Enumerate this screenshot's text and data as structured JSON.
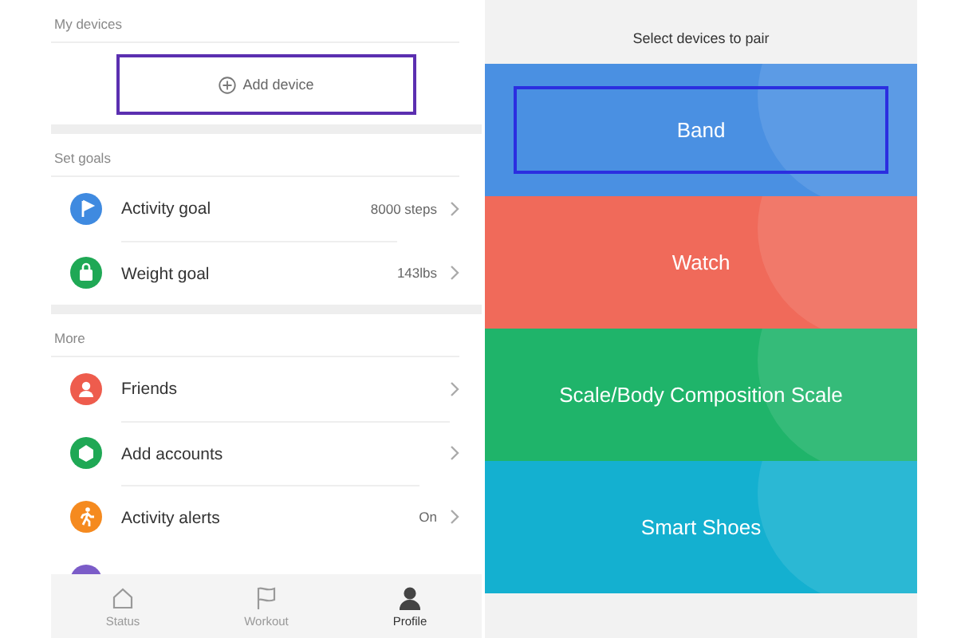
{
  "profile": {
    "my_devices": {
      "heading": "My devices",
      "add_device": {
        "label": "Add device",
        "highlighted": true
      }
    },
    "set_goals": {
      "heading": "Set goals",
      "items": [
        {
          "label": "Activity goal",
          "value": "8000 steps",
          "color": "#3f8ae0"
        },
        {
          "label": "Weight goal",
          "value": "143lbs",
          "color": "#1fa855"
        }
      ]
    },
    "more": {
      "heading": "More",
      "items": [
        {
          "label": "Friends",
          "color": "#ee5c4d"
        },
        {
          "label": "Add accounts",
          "color": "#1fa855"
        },
        {
          "label": "Activity alerts",
          "value": "On",
          "color": "#f58a1f"
        }
      ]
    },
    "tab_bar": [
      {
        "label": "Status",
        "selected": false
      },
      {
        "label": "Workout",
        "selected": false
      },
      {
        "label": "Profile",
        "selected": true
      }
    ]
  },
  "pair": {
    "title": "Select devices to pair",
    "devices": [
      {
        "label": "Band",
        "color": "#4a90e2",
        "highlighted": true
      },
      {
        "label": "Watch",
        "color": "#f06a5a",
        "highlighted": false
      },
      {
        "label": "Scale/Body Composition Scale",
        "color": "#1fb46a",
        "highlighted": false
      },
      {
        "label": "Smart Shoes",
        "color": "#14b0d0",
        "highlighted": false
      }
    ]
  }
}
